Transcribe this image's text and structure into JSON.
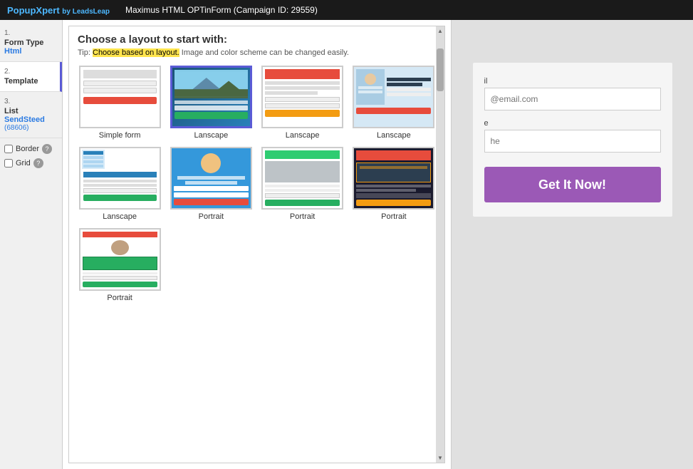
{
  "topbar": {
    "brand_name": "PopupXpert",
    "brand_sub": "by LeadsLeap",
    "campaign_title": "Maximus HTML OPTinForm (Campaign ID: 29559)"
  },
  "sidebar": {
    "step1_num": "1.",
    "step1_label": "Form Type",
    "step1_value": "Html",
    "step2_num": "2.",
    "step2_label": "Template",
    "step3_num": "3.",
    "step3_label": "List",
    "step3_value": "SendSteed",
    "step3_sub": "(68606)",
    "border_label": "Border",
    "grid_label": "Grid"
  },
  "chooser": {
    "title": "Choose a layout to start with:",
    "tip_prefix": "Tip:",
    "tip_highlight": "Choose based on layout.",
    "tip_suffix": "Image and color scheme can be changed easily.",
    "templates": [
      {
        "id": "simple-form",
        "label": "Simple form"
      },
      {
        "id": "lanscape-1",
        "label": "Lanscape"
      },
      {
        "id": "lanscape-2",
        "label": "Lanscape"
      },
      {
        "id": "lanscape-3",
        "label": "Lanscape"
      },
      {
        "id": "lanscape-4",
        "label": "Lanscape"
      },
      {
        "id": "portrait-1",
        "label": "Portrait"
      },
      {
        "id": "portrait-2",
        "label": "Portrait"
      },
      {
        "id": "portrait-3",
        "label": "Portrait"
      },
      {
        "id": "portrait-4",
        "label": "Portrait"
      }
    ]
  },
  "form_preview": {
    "email_label": "il",
    "email_placeholder": "@email.com",
    "name_label": "e",
    "name_placeholder": "he",
    "cta_button": "Get It Now!"
  }
}
